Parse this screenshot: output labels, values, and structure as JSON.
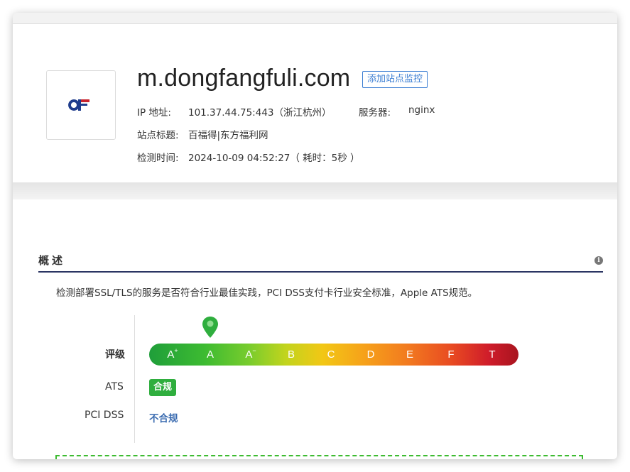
{
  "site": {
    "domain": "m.dongfangfuli.com",
    "monitor_button": "添加站点监控",
    "ip_label": "IP 地址:",
    "ip_value": "101.37.44.75:443（浙江杭州）",
    "server_label": "服务器:",
    "server_value": "nginx",
    "title_label": "站点标题:",
    "title_value": "百福得|东方福利网",
    "time_label": "检测时间:",
    "time_value": "2024-10-09 04:52:27（ 耗时：5秒 ）",
    "logo_icon": "site-logo-af"
  },
  "overview": {
    "title": "概述",
    "info_icon": "info-icon",
    "description": "检测部署SSL/TLS的服务是否符合行业最佳实践，PCI DSS支付卡行业安全标准，Apple ATS规范。",
    "grade_label": "评级",
    "grades": [
      {
        "base": "A",
        "sup": "+"
      },
      {
        "base": "A",
        "sup": ""
      },
      {
        "base": "A",
        "sup": "−"
      },
      {
        "base": "B",
        "sup": ""
      },
      {
        "base": "C",
        "sup": ""
      },
      {
        "base": "D",
        "sup": ""
      },
      {
        "base": "E",
        "sup": ""
      },
      {
        "base": "F",
        "sup": ""
      },
      {
        "base": "T",
        "sup": ""
      }
    ],
    "current_grade": "A",
    "ats_label": "ATS",
    "ats_value": "合规",
    "pci_label": "PCI DSS",
    "pci_value": "不合规",
    "colors": {
      "accent": "#3d7fd3",
      "pass": "#2fae3e",
      "fail_text": "#3a6bb0",
      "rule": "#2b3563"
    }
  }
}
